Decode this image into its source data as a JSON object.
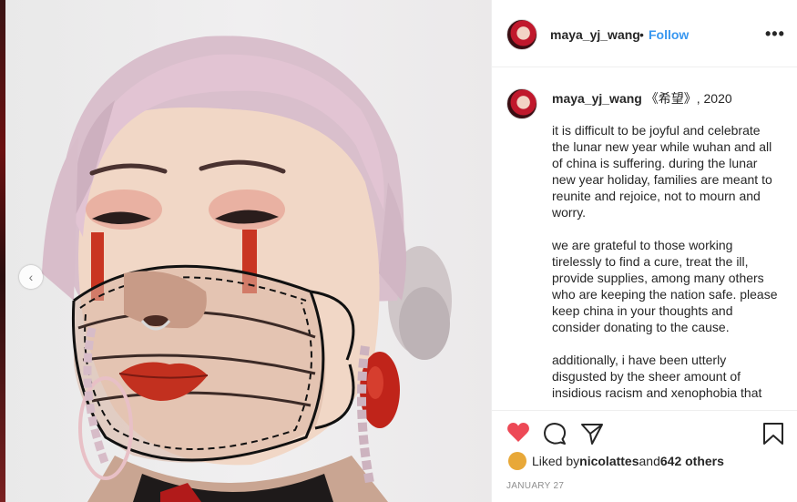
{
  "post": {
    "username": "maya_yj_wang",
    "separator": "•",
    "follow_label": "Follow",
    "more_label": "•••"
  },
  "caption": {
    "username": "maya_yj_wang",
    "title": " 《希望》, 2020",
    "paragraphs": [
      "it is difficult to be joyful and celebrate the lunar new year while wuhan and all of china is suffering. during the lunar new year holiday, families are meant to reunite and rejoice, not to mourn and worry.",
      "we are grateful to those working tirelessly to find a cure, treat the ill, provide supplies, among many others who are keeping the nation safe. please keep china in your thoughts and consider donating to the cause.",
      "additionally, i have been utterly disgusted by the sheer amount of insidious racism and xenophobia that"
    ]
  },
  "likes": {
    "prefix": "Liked by ",
    "user": "nicolattes",
    "middle": " and ",
    "count": "642 others"
  },
  "date": "JANUARY 27",
  "nav": {
    "prev": "‹"
  },
  "icons": {
    "like": "heart-icon",
    "comment": "comment-icon",
    "share": "share-icon",
    "save": "bookmark-icon",
    "more": "more-options-icon"
  },
  "colors": {
    "like": "#ed4956",
    "follow": "#3897f0",
    "text": "#262626",
    "muted": "#8e8e8e"
  }
}
